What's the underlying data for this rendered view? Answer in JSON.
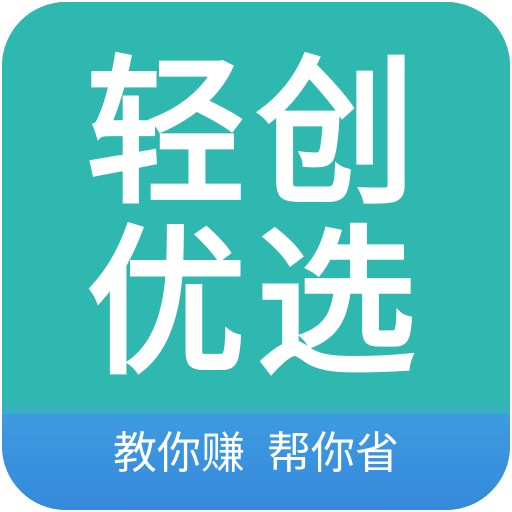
{
  "logo": {
    "title_line_1": "轻创",
    "title_line_2": "优选",
    "tagline_left": "教你赚",
    "tagline_right": "帮你省"
  },
  "colors": {
    "background": "#2FB8B0",
    "band": "#3589DC",
    "text": "#FFFFFF"
  }
}
